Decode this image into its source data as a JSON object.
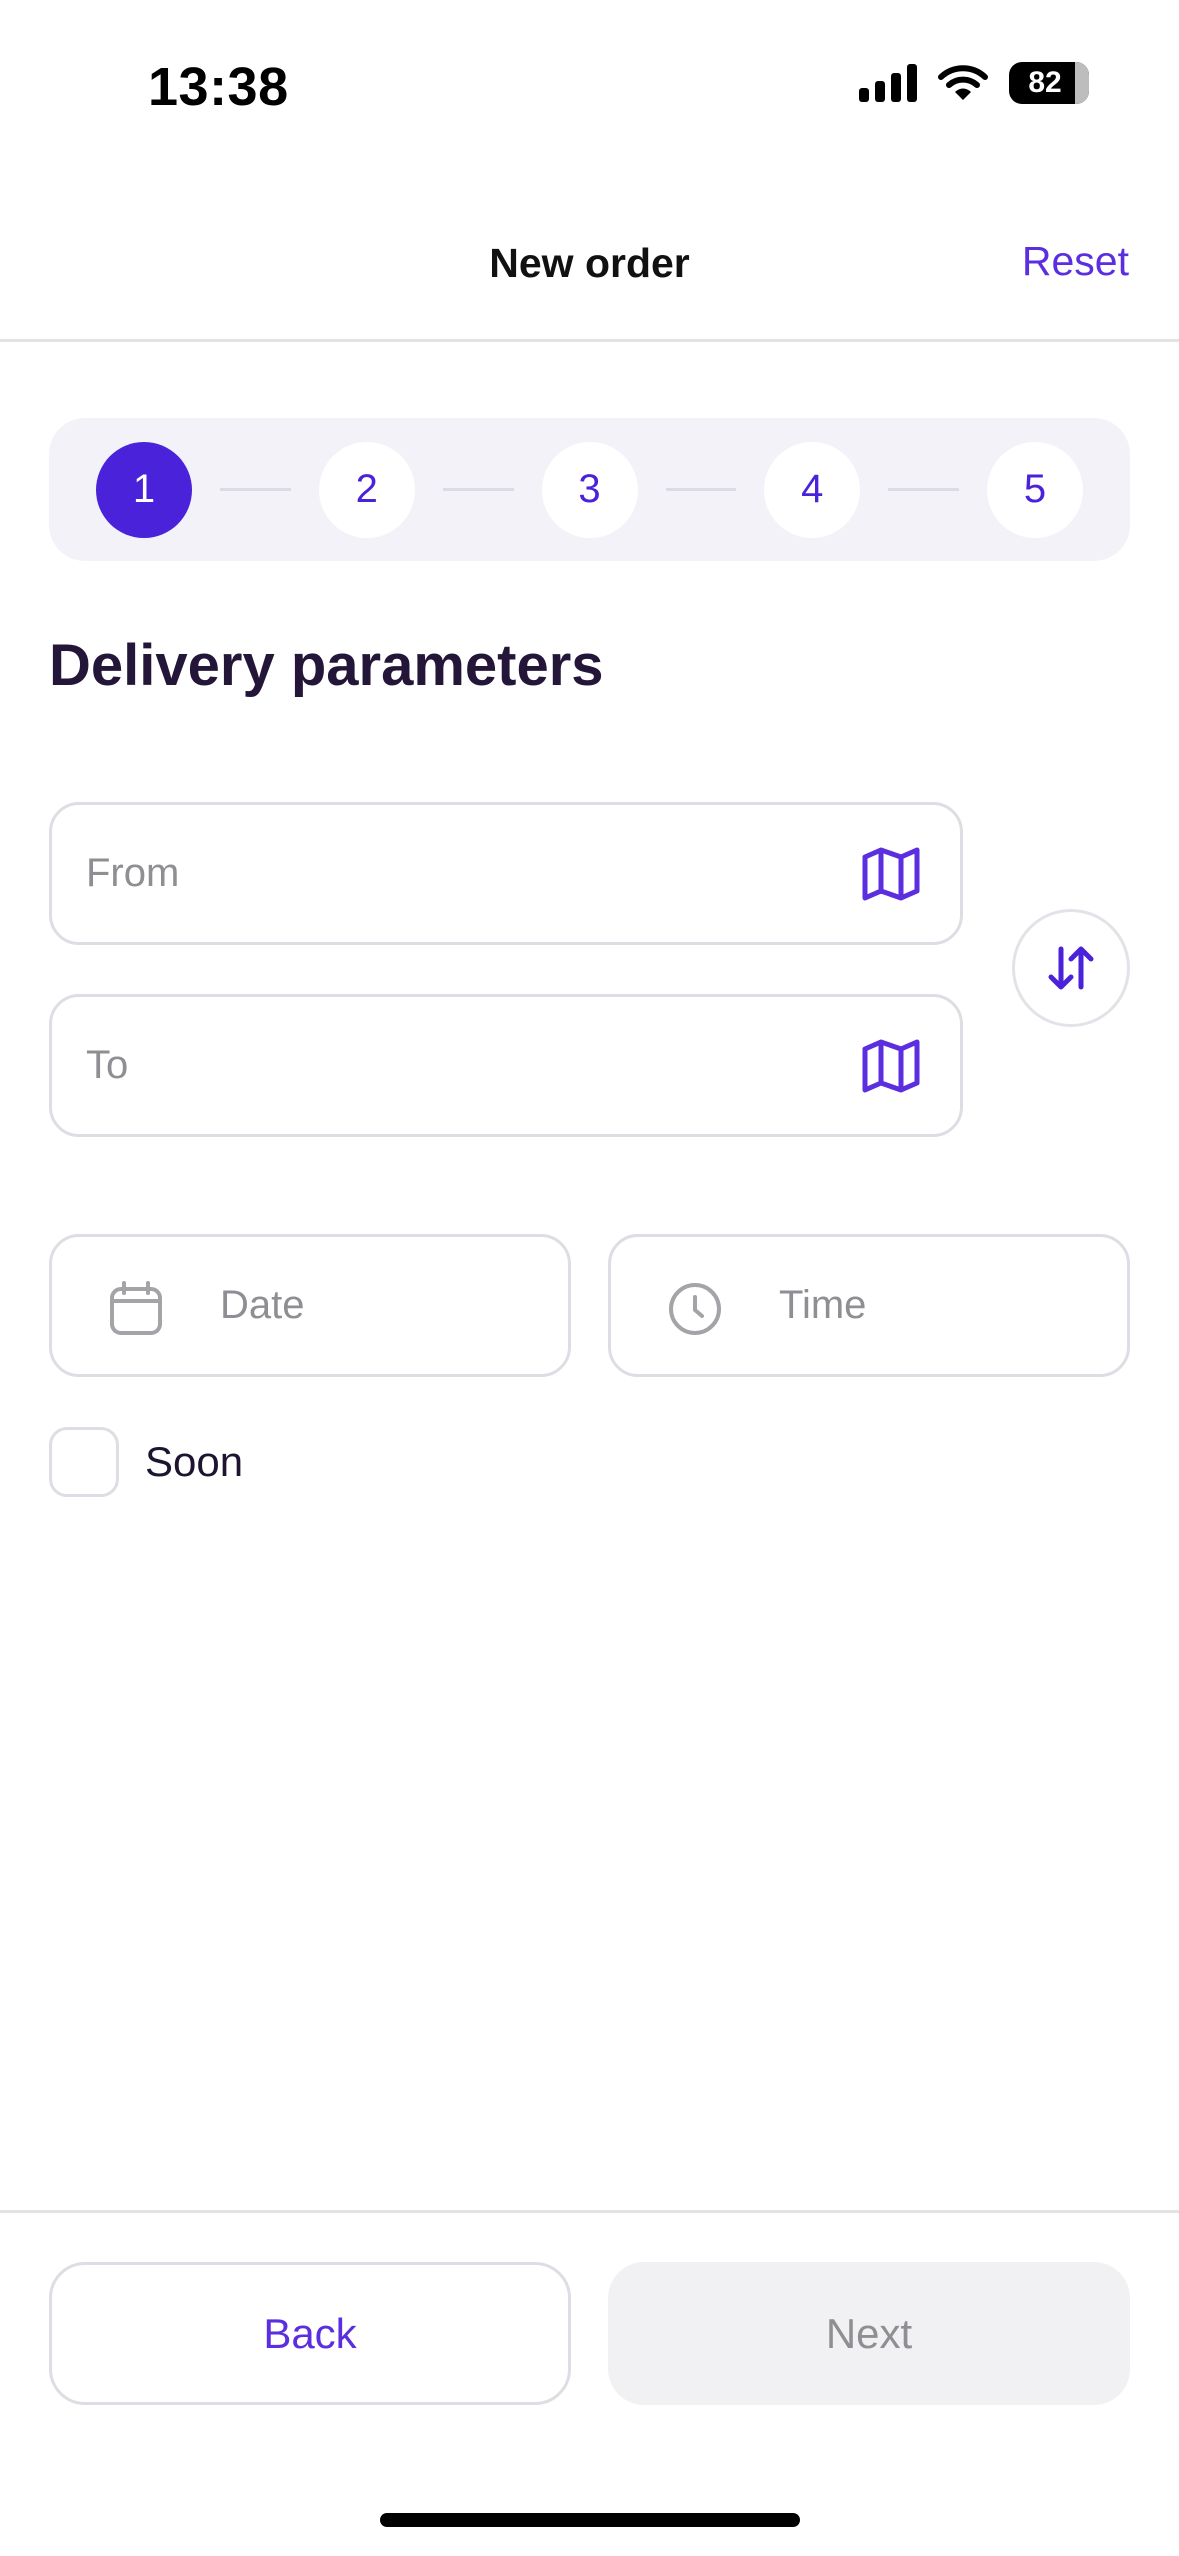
{
  "status_bar": {
    "time": "13:38",
    "battery": "82"
  },
  "header": {
    "title": "New order",
    "reset_label": "Reset"
  },
  "stepper": {
    "steps": [
      "1",
      "2",
      "3",
      "4",
      "5"
    ],
    "active_step": 1
  },
  "section_title": "Delivery parameters",
  "from_field": {
    "placeholder": "From"
  },
  "to_field": {
    "placeholder": "To"
  },
  "date_field": {
    "placeholder": "Date"
  },
  "time_field": {
    "placeholder": "Time"
  },
  "soon_checkbox": {
    "label": "Soon",
    "checked": false
  },
  "footer": {
    "back_label": "Back",
    "next_label": "Next"
  },
  "colors": {
    "accent": "#4a22d9",
    "accent_text": "#5b2ee0",
    "border": "#dedde3",
    "placeholder": "#8e8e93"
  },
  "icons": [
    "cellular-signal-icon",
    "wifi-icon",
    "battery-icon",
    "map-icon",
    "swap-vertical-icon",
    "calendar-icon",
    "clock-icon"
  ]
}
